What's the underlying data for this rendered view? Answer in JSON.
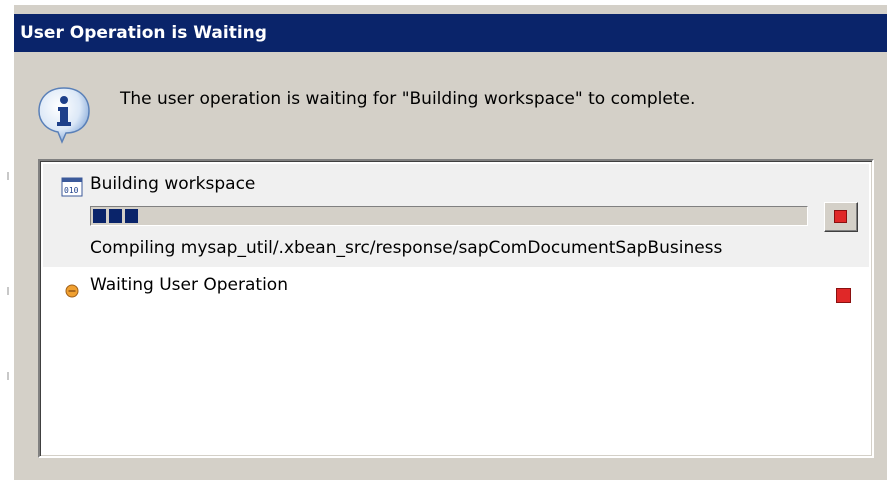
{
  "dialog": {
    "title": "User Operation is Waiting",
    "message": "The user operation is waiting for \"Building workspace\" to complete.",
    "info_icon": "information-icon"
  },
  "jobs": [
    {
      "name": "Building workspace",
      "icon": "binary-file-icon",
      "progress_percent": 6,
      "task": "Compiling mysap_util/.xbean_src/response/sapComDocumentSapBusiness",
      "cancel_icon": "stop-icon"
    },
    {
      "name": "Waiting User Operation",
      "icon": "waiting-status-icon",
      "cancel_icon": "stop-icon"
    }
  ],
  "colors": {
    "title_bar": "#0a246a",
    "title_text": "#ffffff",
    "dialog_bg": "#d4d0c8",
    "progress_fill": "#0a246a",
    "stop_red": "#e02828",
    "waiting_orange": "#f0a030"
  }
}
